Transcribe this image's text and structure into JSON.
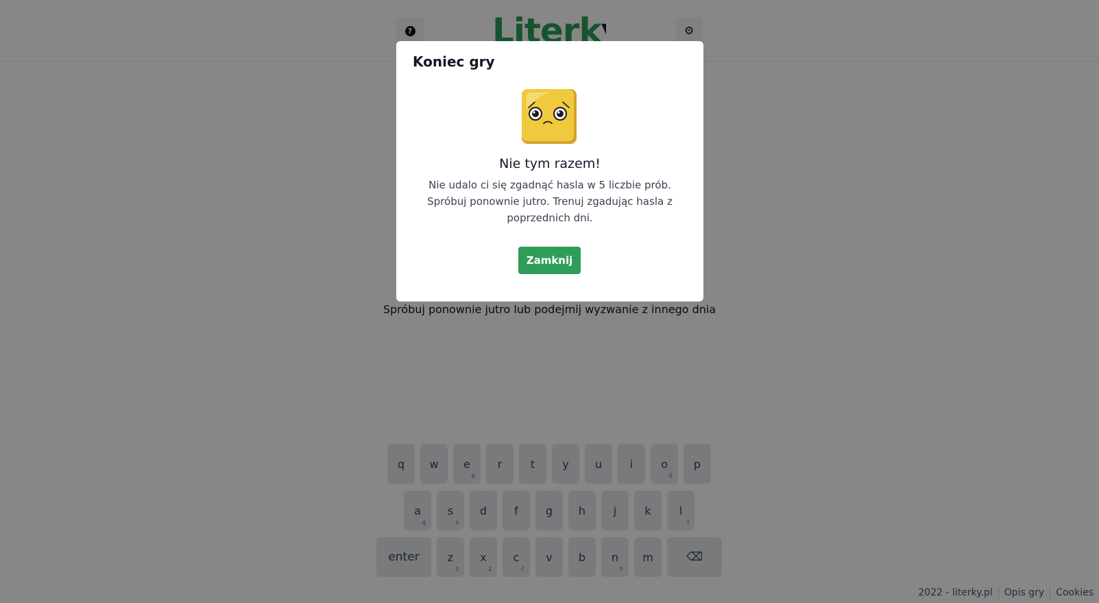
{
  "header": {
    "logo_main": "Literk",
    "logo_tail": "y",
    "help_icon": "question-circle-icon",
    "settings_icon": "gear-icon"
  },
  "game": {
    "status_message": "Spróbuj ponownie jutro lub podejmij wyzwanie z innego dnia"
  },
  "keyboard": {
    "rows": [
      [
        {
          "label": "q",
          "sub": ""
        },
        {
          "label": "w",
          "sub": ""
        },
        {
          "label": "e",
          "sub": "ę"
        },
        {
          "label": "r",
          "sub": ""
        },
        {
          "label": "t",
          "sub": ""
        },
        {
          "label": "y",
          "sub": ""
        },
        {
          "label": "u",
          "sub": ""
        },
        {
          "label": "i",
          "sub": ""
        },
        {
          "label": "o",
          "sub": "ó"
        },
        {
          "label": "p",
          "sub": ""
        }
      ],
      [
        {
          "label": "a",
          "sub": "ą"
        },
        {
          "label": "s",
          "sub": "ś"
        },
        {
          "label": "d",
          "sub": ""
        },
        {
          "label": "f",
          "sub": ""
        },
        {
          "label": "g",
          "sub": ""
        },
        {
          "label": "h",
          "sub": ""
        },
        {
          "label": "j",
          "sub": ""
        },
        {
          "label": "k",
          "sub": ""
        },
        {
          "label": "l",
          "sub": "ł"
        }
      ],
      [
        {
          "label": "enter",
          "sub": "",
          "kind": "enter"
        },
        {
          "label": "z",
          "sub": "ż"
        },
        {
          "label": "x",
          "sub": "ź"
        },
        {
          "label": "c",
          "sub": "ć"
        },
        {
          "label": "v",
          "sub": ""
        },
        {
          "label": "b",
          "sub": ""
        },
        {
          "label": "n",
          "sub": "ń"
        },
        {
          "label": "m",
          "sub": ""
        },
        {
          "label": "⌫",
          "sub": "",
          "kind": "backspace"
        }
      ]
    ]
  },
  "footer": {
    "copyright": "2022 - literky.pl",
    "about_link": "Opis gry",
    "cookies_link": "Cookies"
  },
  "modal": {
    "title": "Koniec gry",
    "mascot_icon": "sad-tile-mascot-icon",
    "heading": "Nie tym razem!",
    "message": "Nie udalo ci się zgadnąć hasla w 5 liczbie prób. Spróbuj ponownie jutro. Trenuj zgadując hasla z poprzednich dni.",
    "close_label": "Zamknij"
  },
  "colors": {
    "brand_green": "#2f9d5a",
    "key_bg": "#e5e7eb",
    "overlay": "rgba(0,0,0,0.47)",
    "mascot_yellow": "#f0c93e"
  }
}
